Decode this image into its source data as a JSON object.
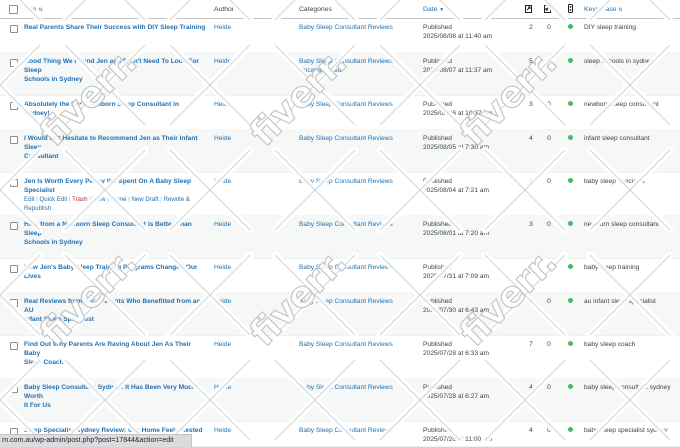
{
  "columns": {
    "title": "Title",
    "author": "Author",
    "categories": "Categories",
    "date": "Date",
    "keyphrase": "Keyphrase"
  },
  "watermark_text": "fiverr.",
  "status_url": "rn.com.au/wp-admin/post.php?post=17844&action=edit",
  "row_actions": {
    "edit": "Edit",
    "quick_edit": "Quick Edit",
    "trash": "Trash",
    "view": "View",
    "clone": "Clone",
    "new_draft": "New Draft",
    "rewrite": "Rewrite &",
    "republish": "Republish"
  },
  "posts": [
    {
      "title_line1": "Real Parents Share Their Success with DIY Sleep Training",
      "title_line2": "",
      "author": "Heide",
      "cat_line1": "Baby Sleep Consultant Reviews",
      "cat_line2": "",
      "status": "Published",
      "date": "2025/08/08 at 11:40 am",
      "n1": "2",
      "n2": "0",
      "keyphrase": "DIY sleep training"
    },
    {
      "title_line1": "Good Thing We Found Jen and Didn't Need To Look For Sleep",
      "title_line2": "Schools in Sydney",
      "author": "Heide",
      "cat_line1": "Baby Sleep Consultant Reviews,",
      "cat_line2": "Uncategorized",
      "status": "Published",
      "date": "2025/08/07 at 11:37 am",
      "n1": "5",
      "n2": "0",
      "keyphrase": "sleep schools in sydney"
    },
    {
      "title_line1": "Absolutely the Best Newborn Sleep Consultant in Sydney!",
      "title_line2": "",
      "author": "Heide",
      "cat_line1": "Baby Sleep Consultant Reviews",
      "cat_line2": "",
      "status": "Published",
      "date": "2025/08/06 at 10:37 am",
      "n1": "3",
      "n2": "0",
      "keyphrase": "newborn sleep consultant"
    },
    {
      "title_line1": "I Would Not Hesitate to Recommend Jen as Their Infant Sleep",
      "title_line2": "Consultant",
      "author": "Heide",
      "cat_line1": "Baby Sleep Consultant Reviews",
      "cat_line2": "",
      "status": "Published",
      "date": "2025/08/05 at 7:30 am",
      "n1": "4",
      "n2": "0",
      "keyphrase": "infant sleep consultant"
    },
    {
      "title_line1": "Jen Is Worth Every Penny We Spent On A Baby Sleep",
      "title_line2": "Specialist",
      "author": "Heide",
      "cat_line1": "Baby Sleep Consultant Reviews",
      "cat_line2": "",
      "status": "Published",
      "date": "2025/08/04 at 7:21 am",
      "n1": "4",
      "n2": "0",
      "keyphrase": "baby sleep specialist"
    },
    {
      "title_line1": "Help from a Newborn Sleep Consultant is Better Than Sleep",
      "title_line2": "Schools in Sydney",
      "author": "Heide",
      "cat_line1": "Baby Sleep Consultant Reviews",
      "cat_line2": "",
      "status": "Published",
      "date": "2025/08/01 at 7:20 am",
      "n1": "3",
      "n2": "0",
      "keyphrase": "newborn sleep consultant"
    },
    {
      "title_line1": "How Jen's Baby Sleep Training Programs Changed Our Lives",
      "title_line2": "",
      "author": "Heide",
      "cat_line1": "Baby Sleep Consultant Reviews",
      "cat_line2": "",
      "status": "Published",
      "date": "2025/07/31 at 7:09 am",
      "n1": "4",
      "n2": "0",
      "keyphrase": "baby sleep training"
    },
    {
      "title_line1": "Real Reviews from Real Parents Who Benefitted from an AU",
      "title_line2": "Infant Sleep Specialist",
      "author": "Heide",
      "cat_line1": "Baby Sleep Consultant Reviews",
      "cat_line2": "",
      "status": "Published",
      "date": "2025/07/30 at 6:43 am",
      "n1": "6",
      "n2": "0",
      "keyphrase": "au infant sleep specialist"
    },
    {
      "title_line1": "Find Out Why Parents Are Raving About Jen As Their Baby",
      "title_line2": "Sleep Coach",
      "author": "Heide",
      "cat_line1": "Baby Sleep Consultant Reviews",
      "cat_line2": "",
      "status": "Published",
      "date": "2025/07/28 at 6:33 am",
      "n1": "7",
      "n2": "0",
      "keyphrase": "baby sleep coach"
    },
    {
      "title_line1": "Baby Sleep Consultant Sydney: It Has Been Very Much Worth",
      "title_line2": "It For Us",
      "author": "Heide",
      "cat_line1": "Baby Sleep Consultant Reviews",
      "cat_line2": "",
      "status": "Published",
      "date": "2025/07/28 at 6:27 am",
      "n1": "4",
      "n2": "0",
      "keyphrase": "baby sleep consultant sydney"
    },
    {
      "title_line1": "Sleep Specialist Sydney Review: Our Home Feels Rested and",
      "title_line2": "",
      "author": "Heide",
      "cat_line1": "Baby Sleep Consultant Reviews",
      "cat_line2": "",
      "status": "Published",
      "date": "2025/07/26 at 11:00 am",
      "n1": "4",
      "n2": "0",
      "keyphrase": "baby sleep specialist sydney"
    }
  ]
}
